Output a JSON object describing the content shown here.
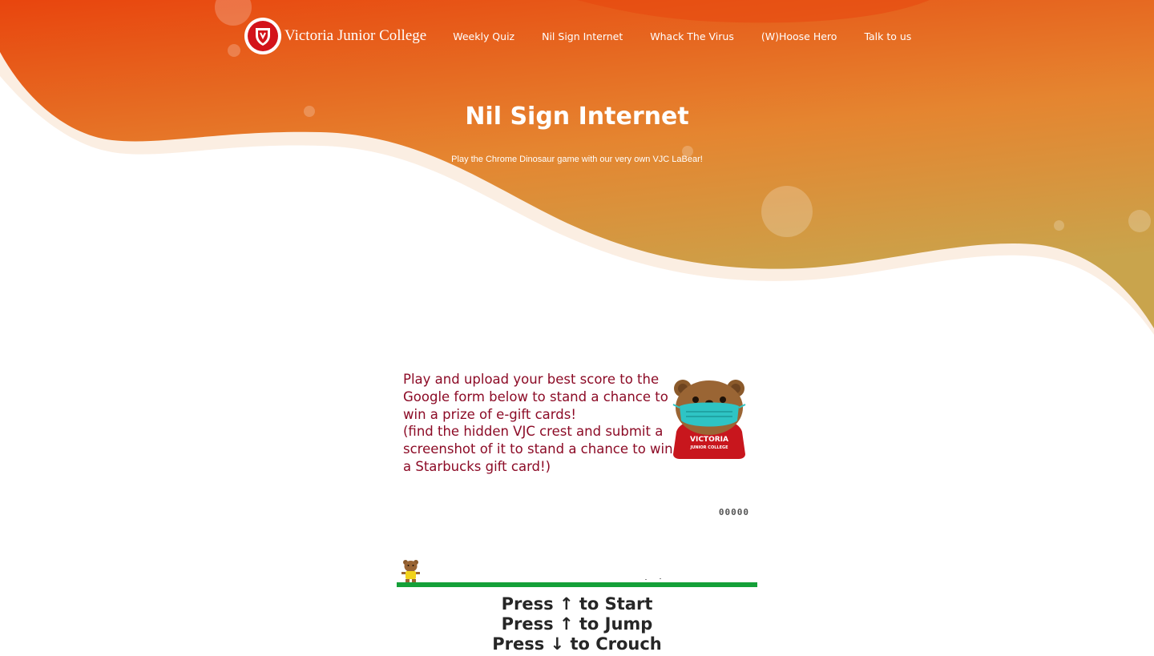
{
  "brand": {
    "name": "Victoria Junior College"
  },
  "nav": {
    "items": [
      {
        "label": "Weekly Quiz"
      },
      {
        "label": "Nil Sign Internet"
      },
      {
        "label": "Whack The Virus"
      },
      {
        "label": "(W)Hoose Hero"
      },
      {
        "label": "Talk to us"
      }
    ]
  },
  "hero": {
    "title": "Nil Sign Internet",
    "subtitle": "Play the Chrome Dinosaur game with our very own VJC LaBear!"
  },
  "game": {
    "instructions": [
      "Play and upload your best score to the",
      "Google form below to stand a chance to",
      "win a prize of e-gift cards!",
      "(find the hidden VJC crest and submit a",
      "screenshot of it to stand a chance to win",
      "a Starbucks gift card!)"
    ],
    "mascot_shirt_line1": "VICTORIA",
    "mascot_shirt_line2": "JUNIOR COLLEGE",
    "score": "00000"
  },
  "controls": {
    "start": "Press ↑ to Start",
    "jump": "Press ↑ to Jump",
    "crouch": "Press ↓ to Crouch"
  },
  "colors": {
    "hero_gradient_top": "#e8470f",
    "hero_gradient_mid": "#e3892e",
    "hero_gradient_bottom": "#c8a24a",
    "wave_highlight": "#fbeee2",
    "instruction_text": "#8c0b26",
    "ground": "#14a038",
    "mascot_mask": "#2ec4c4",
    "mascot_shirt": "#c8161d"
  }
}
